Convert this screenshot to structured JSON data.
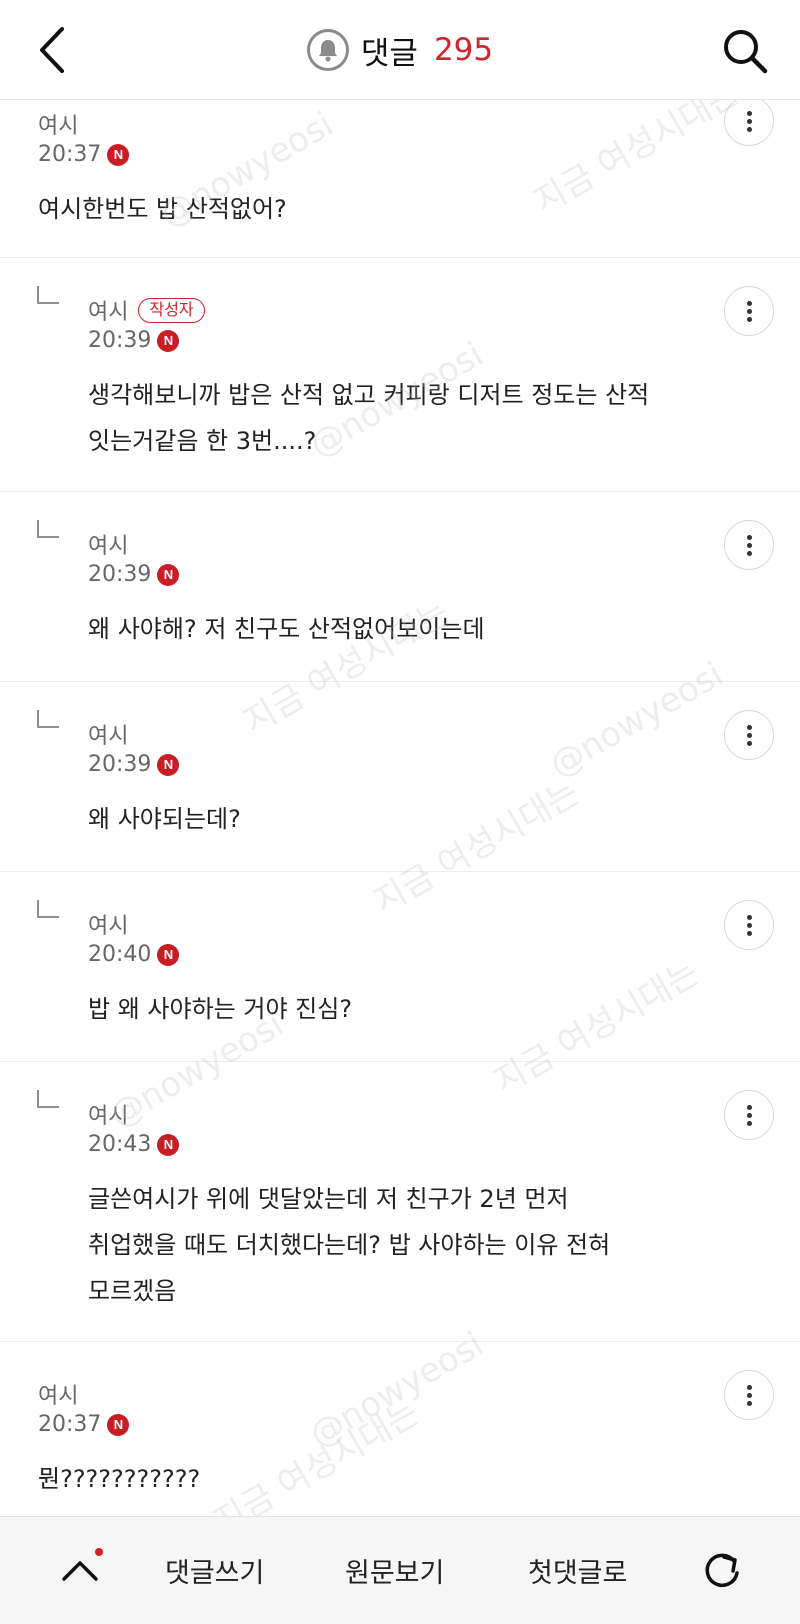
{
  "header": {
    "title": "댓글",
    "count": "295"
  },
  "comments": [
    {
      "author": "여시",
      "time": "20:37",
      "new": "N",
      "text": [
        "여시한번도 밥 산적없어?"
      ],
      "reply": false,
      "op": false
    },
    {
      "author": "여시",
      "time": "20:39",
      "new": "N",
      "text": [
        "생각해보니까 밥은 산적 없고 커피랑 디저트 정도는 산적",
        "잇는거같음 한 3번....?"
      ],
      "reply": true,
      "op": true,
      "op_label": "작성자"
    },
    {
      "author": "여시",
      "time": "20:39",
      "new": "N",
      "text": [
        "왜 사야해? 저 친구도 산적없어보이는데"
      ],
      "reply": true,
      "op": false
    },
    {
      "author": "여시",
      "time": "20:39",
      "new": "N",
      "text": [
        "왜 사야되는데?"
      ],
      "reply": true,
      "op": false
    },
    {
      "author": "여시",
      "time": "20:40",
      "new": "N",
      "text": [
        "밥 왜 사야하는 거야 진심?"
      ],
      "reply": true,
      "op": false
    },
    {
      "author": "여시",
      "time": "20:43",
      "new": "N",
      "text": [
        "글쓴여시가 위에 댓달았는데 저 친구가 2년 먼저",
        "취업했을 때도 더치했다는데? 밥 사야하는 이유 전혀",
        "모르겠음"
      ],
      "reply": true,
      "op": false
    },
    {
      "author": "여시",
      "time": "20:37",
      "new": "N",
      "text": [
        "뭔???????????"
      ],
      "reply": false,
      "op": false
    }
  ],
  "bottom_bar": {
    "write_comment": "댓글쓰기",
    "view_original": "원문보기",
    "first_comment": "첫댓글로"
  },
  "watermark": {
    "site": "@nowyeosi",
    "slogan": "지금 여성시대는"
  },
  "colors": {
    "accent_red": "#d0232b",
    "text": "#222222",
    "meta": "#666666"
  }
}
